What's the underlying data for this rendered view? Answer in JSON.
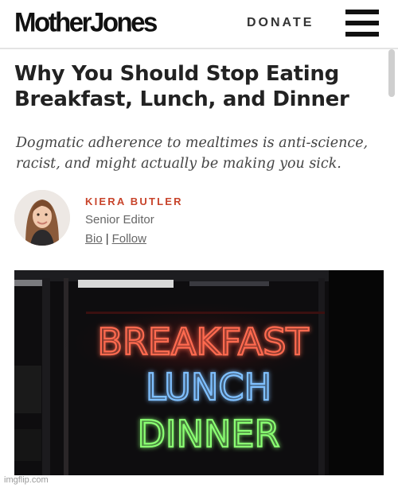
{
  "header": {
    "logo": "MotherJones",
    "donate_label": "DONATE",
    "menu_icon": "hamburger-menu-icon"
  },
  "article": {
    "title": "Why You Should Stop Eating Breakfast, Lunch, and Dinner",
    "dek": "Dogmatic adherence to mealtimes is anti-science, racist, and might actually be making you sick.",
    "author": {
      "name": "KIERA BUTLER",
      "role": "Senior Editor",
      "bio_label": "Bio",
      "separator": "|",
      "follow_label": "Follow"
    },
    "image": {
      "sign_lines": [
        "BREAKFAST",
        "LUNCH",
        "DINNER"
      ],
      "line_colors": [
        "#ff5a46",
        "#6fb3ff",
        "#7dff6a"
      ]
    }
  },
  "watermark": "imgflip.com",
  "colors": {
    "accent": "#c8442b",
    "text": "#222222"
  }
}
